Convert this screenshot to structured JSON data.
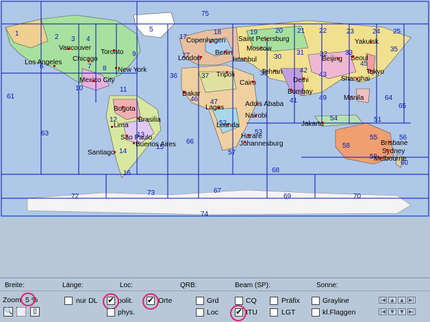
{
  "map": {
    "zones": [
      {
        "id": "z1",
        "label": "1"
      },
      {
        "id": "z2",
        "label": "2"
      },
      {
        "id": "z3",
        "label": "3"
      },
      {
        "id": "z4",
        "label": "4"
      },
      {
        "id": "z5",
        "label": "5"
      },
      {
        "id": "z6",
        "label": "6"
      },
      {
        "id": "z7",
        "label": "7"
      },
      {
        "id": "z8",
        "label": "8"
      },
      {
        "id": "z9",
        "label": "9"
      },
      {
        "id": "z10",
        "label": "10"
      },
      {
        "id": "z11",
        "label": "11"
      },
      {
        "id": "z12",
        "label": "12"
      },
      {
        "id": "z13",
        "label": "13"
      },
      {
        "id": "z14",
        "label": "14"
      },
      {
        "id": "z15",
        "label": "15"
      },
      {
        "id": "z16",
        "label": "16"
      },
      {
        "id": "z17",
        "label": "17"
      },
      {
        "id": "z18",
        "label": "18"
      },
      {
        "id": "z19",
        "label": "19"
      },
      {
        "id": "z20",
        "label": "20"
      },
      {
        "id": "z21",
        "label": "21"
      },
      {
        "id": "z22",
        "label": "22"
      },
      {
        "id": "z23",
        "label": "23"
      },
      {
        "id": "z24",
        "label": "24"
      },
      {
        "id": "z25",
        "label": "25"
      },
      {
        "id": "z27",
        "label": "27"
      },
      {
        "id": "z30",
        "label": "30"
      },
      {
        "id": "z31",
        "label": "31"
      },
      {
        "id": "z32",
        "label": "32"
      },
      {
        "id": "z33",
        "label": "33"
      },
      {
        "id": "z35",
        "label": "35"
      },
      {
        "id": "z36",
        "label": "36"
      },
      {
        "id": "z37",
        "label": "37"
      },
      {
        "id": "z39",
        "label": "39"
      },
      {
        "id": "z41",
        "label": "41"
      },
      {
        "id": "z42",
        "label": "42"
      },
      {
        "id": "z43",
        "label": "43"
      },
      {
        "id": "z45",
        "label": "45"
      },
      {
        "id": "z46",
        "label": "46"
      },
      {
        "id": "z47",
        "label": "47"
      },
      {
        "id": "z49",
        "label": "49"
      },
      {
        "id": "z51",
        "label": "51"
      },
      {
        "id": "z52",
        "label": "52"
      },
      {
        "id": "z53",
        "label": "53"
      },
      {
        "id": "z54",
        "label": "54"
      },
      {
        "id": "z55",
        "label": "55"
      },
      {
        "id": "z56",
        "label": "56"
      },
      {
        "id": "z57",
        "label": "57"
      },
      {
        "id": "z58",
        "label": "58"
      },
      {
        "id": "z59",
        "label": "59"
      },
      {
        "id": "z60",
        "label": "60"
      },
      {
        "id": "z61",
        "label": "61"
      },
      {
        "id": "z63",
        "label": "63"
      },
      {
        "id": "z64",
        "label": "64"
      },
      {
        "id": "z65",
        "label": "65"
      },
      {
        "id": "z66",
        "label": "66"
      },
      {
        "id": "z67",
        "label": "67"
      },
      {
        "id": "z68",
        "label": "68"
      },
      {
        "id": "z69",
        "label": "69"
      },
      {
        "id": "z70",
        "label": "70"
      },
      {
        "id": "z72",
        "label": "72"
      },
      {
        "id": "z73",
        "label": "73"
      },
      {
        "id": "z74",
        "label": "74"
      },
      {
        "id": "z75",
        "label": "75"
      }
    ],
    "cities": [
      {
        "id": "c1",
        "label": "Vancouver"
      },
      {
        "id": "c2",
        "label": "Toronto"
      },
      {
        "id": "c3",
        "label": "Chicago"
      },
      {
        "id": "c4",
        "label": "Los Angeles"
      },
      {
        "id": "c5",
        "label": "New York"
      },
      {
        "id": "c6",
        "label": "Mexico City"
      },
      {
        "id": "c7",
        "label": "Bogota"
      },
      {
        "id": "c8",
        "label": "Lima"
      },
      {
        "id": "c9",
        "label": "Brasilia"
      },
      {
        "id": "c10",
        "label": "Sao Paulo"
      },
      {
        "id": "c11",
        "label": "Buenos Aires"
      },
      {
        "id": "c12",
        "label": "Santiago"
      },
      {
        "id": "c13",
        "label": "Copenhagen"
      },
      {
        "id": "c14",
        "label": "Saint Petersburg"
      },
      {
        "id": "c15",
        "label": "Berlin"
      },
      {
        "id": "c16",
        "label": "Moscow"
      },
      {
        "id": "c17",
        "label": "London"
      },
      {
        "id": "c18",
        "label": "Istanbul"
      },
      {
        "id": "c19",
        "label": "Tripoli"
      },
      {
        "id": "c20",
        "label": "Cairo"
      },
      {
        "id": "c21",
        "label": "Tehran"
      },
      {
        "id": "c22",
        "label": "Dakar"
      },
      {
        "id": "c23",
        "label": "Addis Ababa"
      },
      {
        "id": "c24",
        "label": "Lagos"
      },
      {
        "id": "c25",
        "label": "Nairobi"
      },
      {
        "id": "c26",
        "label": "Luanda"
      },
      {
        "id": "c27",
        "label": "Harare"
      },
      {
        "id": "c28",
        "label": "Johannesburg"
      },
      {
        "id": "c29",
        "label": "Delhi"
      },
      {
        "id": "c30",
        "label": "Bombay"
      },
      {
        "id": "c31",
        "label": "Beijing"
      },
      {
        "id": "c32",
        "label": "Seoul"
      },
      {
        "id": "c33",
        "label": "Yakutsk"
      },
      {
        "id": "c34",
        "label": "Tokyo"
      },
      {
        "id": "c35",
        "label": "Shanghai"
      },
      {
        "id": "c36",
        "label": "Manila"
      },
      {
        "id": "c37",
        "label": "Jakarta"
      },
      {
        "id": "c38",
        "label": "Brisbane"
      },
      {
        "id": "c39",
        "label": "Sydney"
      },
      {
        "id": "c40",
        "label": "Melbourne"
      }
    ]
  },
  "headers": {
    "breite": "Breite:",
    "laenge": "Länge:",
    "loc": "Loc:",
    "qrb": "QRB:",
    "beam": "Beam (SP):",
    "sonne": "Sonne:"
  },
  "zoom": {
    "label": "Zoom",
    "value": "5",
    "unit": "%"
  },
  "options": {
    "nur_dl": {
      "label": "nur DL",
      "checked": false
    },
    "polit": {
      "label": "polit.",
      "checked": true
    },
    "phys": {
      "label": "phys.",
      "checked": false
    },
    "orte": {
      "label": "Orte",
      "checked": true
    },
    "grd": {
      "label": "Grd",
      "checked": false
    },
    "loc": {
      "label": "Loc",
      "checked": false
    },
    "cq": {
      "label": "CQ",
      "checked": false
    },
    "itu": {
      "label": "ITU",
      "checked": true
    },
    "praefix": {
      "label": "Präfix",
      "checked": false
    },
    "lgt": {
      "label": "LGT",
      "checked": false
    },
    "grayline": {
      "label": "Grayline",
      "checked": false
    },
    "kl_flaggen": {
      "label": "kl.Flaggen",
      "checked": false
    }
  },
  "colors": {
    "ocean": "#b0c8e8",
    "grid": "#0018b0",
    "highlight": "#e0206a",
    "panel": "#b9c8d8"
  },
  "icons": {
    "zoom_tool": "magnifier-icon",
    "select_tool": "dotted-rect-icon",
    "page_tool": "page-icon",
    "nav": [
      "first-icon",
      "prev-icon",
      "next-icon",
      "last-icon",
      "first-down-icon",
      "down-icon",
      "up-icon",
      "last-up-icon"
    ]
  }
}
